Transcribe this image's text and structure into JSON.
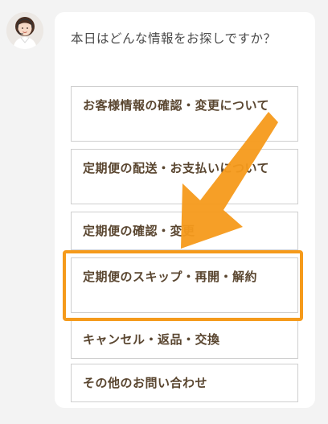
{
  "chat": {
    "avatar_icon": "operator-woman-avatar-icon",
    "prompt": "本日はどんな情報をお探しですか？"
  },
  "options": [
    {
      "label": "お客様情報の確認・変更について"
    },
    {
      "label": "定期便の配送・お支払いについて"
    },
    {
      "label": "定期便の確認・変更"
    },
    {
      "label": "定期便のスキップ・再開・解約"
    },
    {
      "label": "キャンセル・返品・交換"
    },
    {
      "label": "その他のお問い合わせ"
    }
  ],
  "annotations": {
    "highlight_color": "#f59a1b",
    "arrow_icon": "orange-pointer-arrow-icon"
  }
}
